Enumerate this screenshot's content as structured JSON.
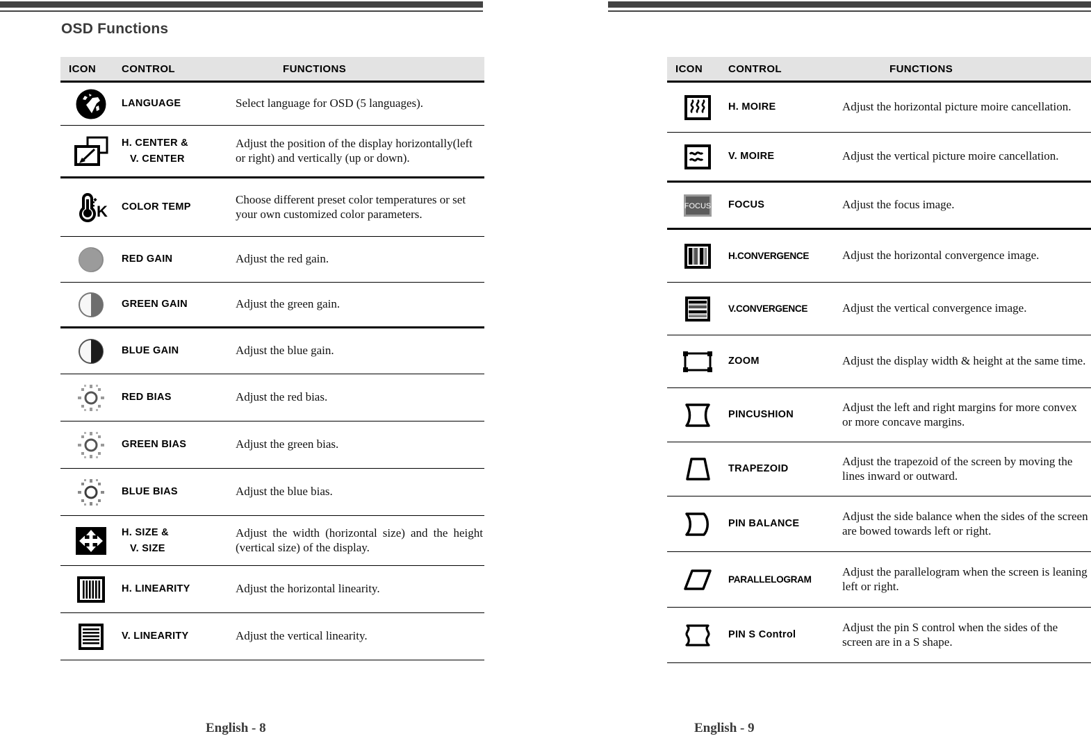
{
  "left_page": {
    "title": "OSD Functions",
    "footer": "English - 8",
    "table": {
      "headers": {
        "icon": "ICON",
        "control": "CONTROL",
        "functions": "FUNCTIONS"
      },
      "rows": [
        {
          "icon": "globe-icon",
          "control": "LANGUAGE",
          "control2": "",
          "function": "Select language for OSD (5 languages)."
        },
        {
          "icon": "position-arrow-icon",
          "control": "H. CENTER &",
          "control2": "V. CENTER",
          "function": "Adjust the position of the display horizontally(left or right) and vertically (up or down)."
        },
        {
          "icon": "thermometer-kelvin-icon",
          "control": "COLOR TEMP",
          "control2": "",
          "function": "Choose different preset color temperatures or set your own customized color parameters."
        },
        {
          "icon": "half-circle-light-icon",
          "control": "RED GAIN",
          "control2": "",
          "function": "Adjust the red gain."
        },
        {
          "icon": "half-circle-mid-icon",
          "control": "GREEN GAIN",
          "control2": "",
          "function": "Adjust the green gain."
        },
        {
          "icon": "half-circle-dark-icon",
          "control": "BLUE GAIN",
          "control2": "",
          "function": "Adjust the blue gain."
        },
        {
          "icon": "brightness-sun-icon",
          "control": "RED BIAS",
          "control2": "",
          "function": "Adjust the red bias."
        },
        {
          "icon": "brightness-sun-icon",
          "control": "GREEN BIAS",
          "control2": "",
          "function": "Adjust the green bias."
        },
        {
          "icon": "brightness-sun-icon",
          "control": "BLUE BIAS",
          "control2": "",
          "function": "Adjust the blue bias."
        },
        {
          "icon": "four-arrows-icon",
          "control": "H. SIZE &",
          "control2": "V. SIZE",
          "function": "Adjust the width (horizontal size) and the height (vertical size) of the display."
        },
        {
          "icon": "vertical-bars-icon",
          "control": "H. LINEARITY",
          "control2": "",
          "function": "Adjust the horizontal linearity."
        },
        {
          "icon": "horizontal-bars-icon",
          "control": "V. LINEARITY",
          "control2": "",
          "function": "Adjust the vertical linearity."
        }
      ]
    }
  },
  "right_page": {
    "footer": "English - 9",
    "table": {
      "headers": {
        "icon": "ICON",
        "control": "CONTROL",
        "functions": "FUNCTIONS"
      },
      "rows": [
        {
          "icon": "h-moire-icon",
          "control": "H. MOIRE",
          "function": "Adjust the horizontal picture moire cancellation."
        },
        {
          "icon": "v-moire-icon",
          "control": "V. MOIRE",
          "function": "Adjust the vertical picture moire cancellation."
        },
        {
          "icon": "focus-box-icon",
          "icon_label": "FOCUS",
          "control": "FOCUS",
          "function": "Adjust the focus image."
        },
        {
          "icon": "h-convergence-icon",
          "control": "H.CONVERGENCE",
          "function": "Adjust the horizontal convergence image."
        },
        {
          "icon": "v-convergence-icon",
          "control": "V.CONVERGENCE",
          "function": "Adjust the vertical convergence image."
        },
        {
          "icon": "zoom-rect-icon",
          "control": "ZOOM",
          "function": "Adjust the display width & height at the same time."
        },
        {
          "icon": "pincushion-icon",
          "control": "PINCUSHION",
          "function": "Adjust the left and right margins for more convex or more concave margins."
        },
        {
          "icon": "trapezoid-icon",
          "control": "TRAPEZOID",
          "function": "Adjust the trapezoid of the screen by moving the lines inward or outward."
        },
        {
          "icon": "pin-balance-icon",
          "control": "PIN BALANCE",
          "function": "Adjust the side balance when the sides of the screen are bowed towards left or right."
        },
        {
          "icon": "parallelogram-icon",
          "control": "PARALLELOGRAM",
          "function": "Adjust the parallelogram when the screen is leaning left or right."
        },
        {
          "icon": "pin-s-control-icon",
          "control": "PIN S Control",
          "function": "Adjust the pin S control when the sides of the screen are in a S shape."
        }
      ]
    }
  },
  "colors": {
    "rule": "#434343",
    "header_band": "#e3e3e3",
    "ink": "#000000",
    "focus_box": "#808080",
    "gain_light": "#9b9b9b",
    "gain_mid": "#6e6e6e",
    "gain_dark": "#1c1c1c"
  }
}
